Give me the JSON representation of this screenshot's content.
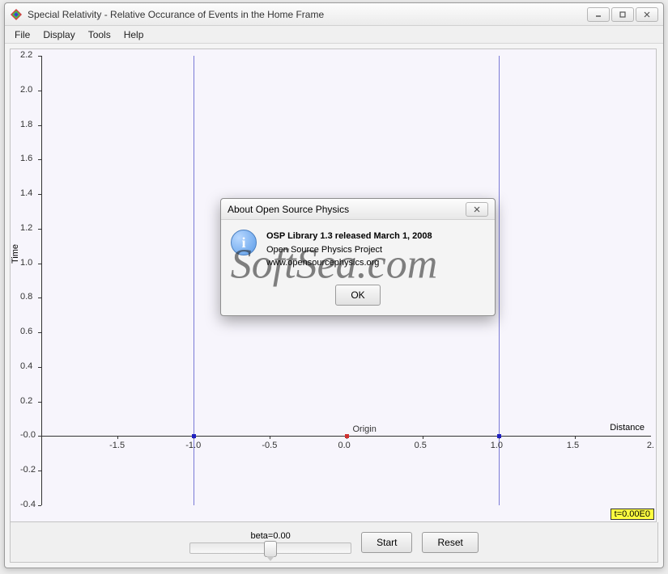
{
  "window": {
    "title": "Special Relativity - Relative Occurance of Events in the Home Frame",
    "controls": {
      "min": "minimize",
      "max": "maximize",
      "close": "close"
    }
  },
  "menubar": {
    "file": "File",
    "display": "Display",
    "tools": "Tools",
    "help": "Help"
  },
  "chart_data": {
    "type": "scatter",
    "xlabel": "Distance",
    "ylabel": "Time",
    "xlim": [
      -2.0,
      2.0
    ],
    "ylim": [
      -0.4,
      2.2
    ],
    "xticks": [
      -1.5,
      -1.0,
      -0.5,
      0.0,
      0.5,
      1.0,
      1.5
    ],
    "yticks": [
      -0.4,
      -0.2,
      -0.0,
      0.2,
      0.4,
      0.6,
      0.8,
      1.0,
      1.2,
      1.4,
      1.6,
      1.8,
      2.0,
      2.2
    ],
    "vertical_lines": [
      -1.0,
      1.0
    ],
    "points": [
      {
        "x": -1.0,
        "y": 0.0,
        "color": "blue",
        "label": ""
      },
      {
        "x": 0.0,
        "y": 0.0,
        "color": "red",
        "label": "Origin"
      },
      {
        "x": 1.0,
        "y": 0.0,
        "color": "blue",
        "label": ""
      }
    ],
    "time_badge": "t=0.00E0",
    "xtick_labels": [
      "-1.5",
      "-1.0",
      "-0.5",
      "0.0",
      "0.5",
      "1.0",
      "1.5"
    ],
    "ytick_labels": [
      "-0.4",
      "-0.2",
      "-0.0",
      "0.2",
      "0.4",
      "0.6",
      "0.8",
      "1.0",
      "1.2",
      "1.4",
      "1.6",
      "1.8",
      "2.0",
      "2.2"
    ],
    "right_xtick": "2."
  },
  "controls": {
    "slider_label": "beta=0.00",
    "start": "Start",
    "reset": "Reset"
  },
  "dialog": {
    "title": "About Open Source Physics",
    "line1": "OSP Library 1.3 released March 1, 2008",
    "line2": "Open Source Physics Project",
    "line3": "www.opensourcephysics.org",
    "ok": "OK"
  },
  "watermark": "SoftSea.com"
}
